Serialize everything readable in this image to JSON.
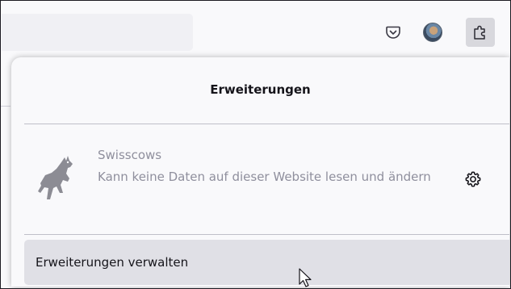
{
  "toolbar": {
    "pocket_icon": "pocket-icon",
    "avatar_icon": "account-avatar-icon",
    "extensions_icon": "extensions-puzzle-icon"
  },
  "panel": {
    "title": "Erweiterungen",
    "extension": {
      "name": "Swisscows",
      "description": "Kann keine Daten auf dieser Website lesen und ändern",
      "icon": "swisscows-icon",
      "settings_icon": "gear-icon"
    },
    "manage_label": "Erweiterungen verwalten"
  },
  "colors": {
    "panel_bg": "#f9f9fb",
    "urlbar_bg": "#f0f0f4",
    "active_button_bg": "#d8d8dd",
    "manage_button_bg": "#e0e0e6",
    "disabled_text": "#8f8f9d"
  }
}
